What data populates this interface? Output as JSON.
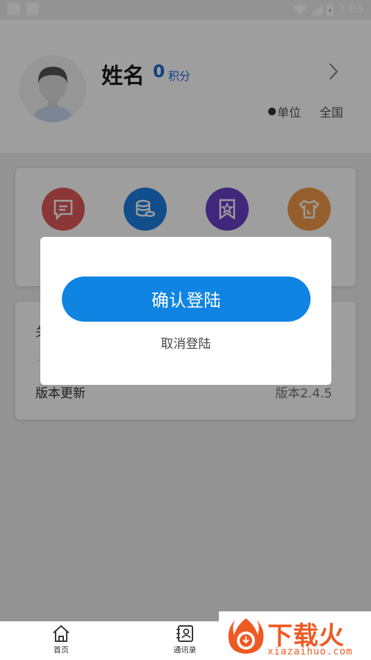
{
  "status_bar": {
    "time": "3:05",
    "icons": [
      "notification-square-icon",
      "notification-square-icon",
      "wifi-icon",
      "signal-icon",
      "battery-charging-icon"
    ]
  },
  "profile": {
    "name": "姓名",
    "points_value": "0",
    "points_label": "积分",
    "unit_label": "单位",
    "region": "全国",
    "avatar_icon": "default-avatar-icon",
    "chevron_icon": "chevron-right-icon"
  },
  "feature_icons": [
    {
      "icon": "message-icon",
      "color": "#e05a5a"
    },
    {
      "icon": "database-coins-icon",
      "color": "#1d7fe0"
    },
    {
      "icon": "star-bookmark-icon",
      "color": "#6a3fc8"
    },
    {
      "icon": "tshirt-icon",
      "color": "#f19a4a"
    }
  ],
  "settings": {
    "first_row_label_partial": "关",
    "version_label": "版本更新",
    "version_value": "版本2.4.5"
  },
  "dialog": {
    "confirm_label": "确认登陆",
    "cancel_label": "取消登陆",
    "accent_color": "#0f84e3"
  },
  "bottom_nav": {
    "items": [
      {
        "label": "首页",
        "icon": "home-icon"
      },
      {
        "label": "通讯录",
        "icon": "contacts-icon"
      }
    ]
  },
  "watermark": {
    "title": "下载火",
    "subtitle": "xiazaihuo.com"
  }
}
